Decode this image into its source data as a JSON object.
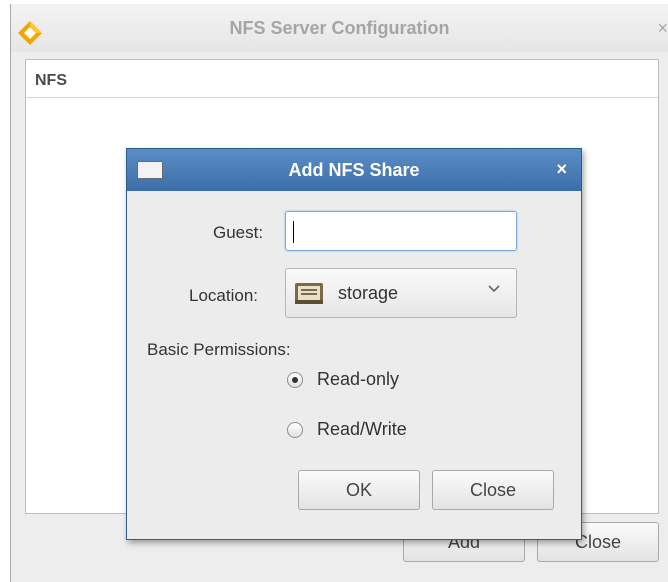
{
  "main_window": {
    "title": "NFS Server Configuration",
    "close_glyph": "×",
    "panel_header": "NFS",
    "buttons": {
      "add_label": "Add",
      "close_label": "Close"
    }
  },
  "dialog": {
    "title": "Add NFS Share",
    "close_glyph": "×",
    "guest_label": "Guest:",
    "guest_value": "",
    "location_label": "Location:",
    "location_value": "storage",
    "permissions_label": "Basic Permissions:",
    "permissions": [
      {
        "label": "Read-only",
        "selected": true
      },
      {
        "label": "Read/Write",
        "selected": false
      }
    ],
    "ok_label": "OK",
    "close_label": "Close"
  },
  "icons": {
    "app_logo": "app-logo-icon",
    "folder": "folder-icon",
    "dropdown": "chevron-down-icon",
    "close": "close-icon"
  },
  "colors": {
    "dialog_titlebar": "#4a7db8",
    "focus_border": "#7fa7d6",
    "logo": "#f5a400"
  }
}
